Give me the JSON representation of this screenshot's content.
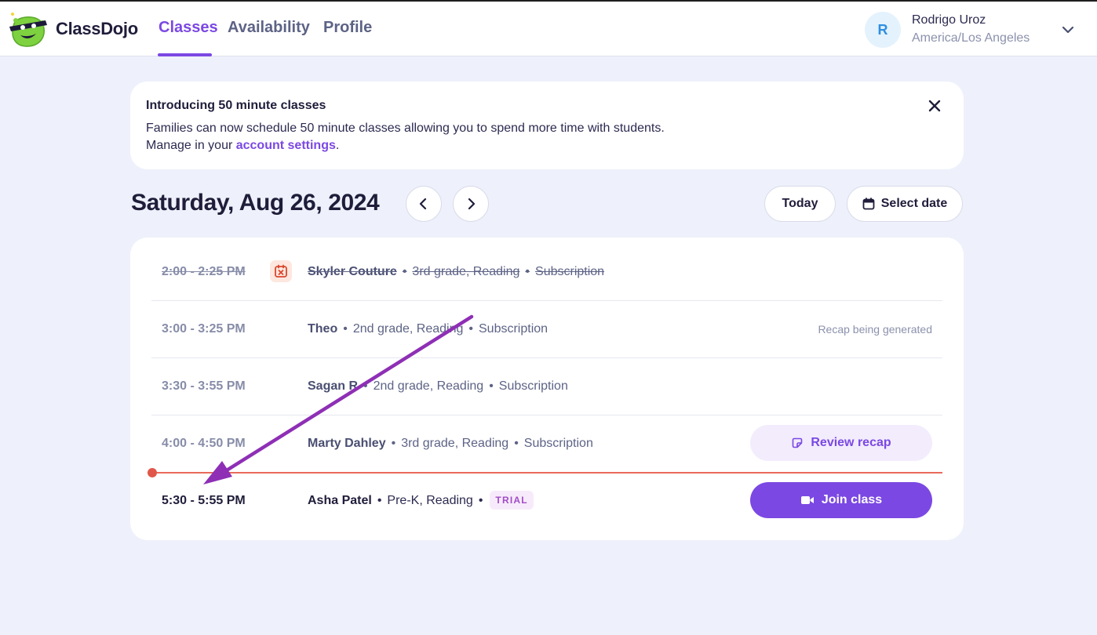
{
  "header": {
    "brand": "ClassDojo",
    "tabs": [
      {
        "label": "Classes",
        "active": true
      },
      {
        "label": "Availability",
        "active": false
      },
      {
        "label": "Profile",
        "active": false
      }
    ],
    "user": {
      "initial": "R",
      "name": "Rodrigo Uroz",
      "timezone": "America/Los Angeles"
    }
  },
  "announcement": {
    "title": "Introducing 50 minute classes",
    "line1": "Families can now schedule 50 minute classes allowing you to spend more time with students.",
    "line2_prefix": "Manage in your ",
    "link_text": "account settings",
    "line2_suffix": "."
  },
  "date_nav": {
    "date": "Saturday, Aug 26, 2024",
    "today_label": "Today",
    "select_date_label": "Select date"
  },
  "classes": [
    {
      "time": "2:00 - 2:25 PM",
      "student": "Skyler Couture",
      "grade": "3rd grade, Reading",
      "type": "Subscription",
      "status": "canceled"
    },
    {
      "time": "3:00 - 3:25 PM",
      "student": "Theo",
      "grade": "2nd grade, Reading",
      "type": "Subscription",
      "status": "Recap being generated"
    },
    {
      "time": "3:30 - 3:55 PM",
      "student": "Sagan R",
      "grade": "2nd grade, Reading",
      "type": "Subscription"
    },
    {
      "time": "4:00 - 4:50 PM",
      "student": "Marty Dahley",
      "grade": "3rd grade, Reading",
      "type": "Subscription",
      "action": "Review recap"
    },
    {
      "time": "5:30 - 5:55 PM",
      "student": "Asha Patel",
      "grade": "Pre-K, Reading",
      "badge": "TRIAL",
      "action": "Join class"
    }
  ],
  "colors": {
    "accent": "#7b48e3",
    "now_line": "#e86a5a",
    "annotation_arrow": "#8e2fb5"
  },
  "icons": [
    "classdojo-monster-logo",
    "chevron-down-icon",
    "close-icon",
    "chevron-left-icon",
    "chevron-right-icon",
    "calendar-icon",
    "calendar-cancel-icon",
    "recap-icon",
    "video-camera-icon"
  ]
}
